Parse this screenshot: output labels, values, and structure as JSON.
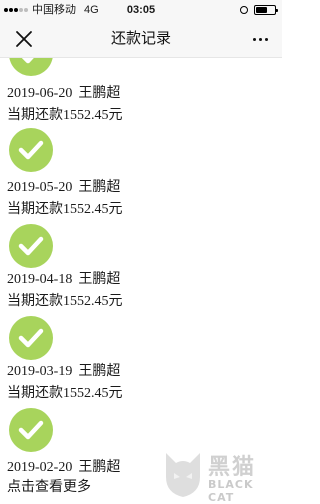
{
  "status_bar": {
    "carrier": "中国移动",
    "network": "4G",
    "time": "03:05"
  },
  "nav": {
    "title": "还款记录",
    "close_icon": "close-icon",
    "more_icon": "more-icon"
  },
  "records": [
    {
      "date": "2019-06-20",
      "name": "王鹏超",
      "amount_text": "当期还款1552.45元"
    },
    {
      "date": "2019-05-20",
      "name": "王鹏超",
      "amount_text": "当期还款1552.45元"
    },
    {
      "date": "2019-04-18",
      "name": "王鹏超",
      "amount_text": "当期还款1552.45元"
    },
    {
      "date": "2019-03-19",
      "name": "王鹏超",
      "amount_text": "当期还款1552.45元"
    },
    {
      "date": "2019-02-20",
      "name": "王鹏超"
    }
  ],
  "load_more": "点击查看更多",
  "watermark": {
    "cn": "黑猫",
    "en": "BLACK CAT"
  },
  "colors": {
    "check_green": "#a8d45c",
    "nav_bg": "#f7f7f7"
  }
}
